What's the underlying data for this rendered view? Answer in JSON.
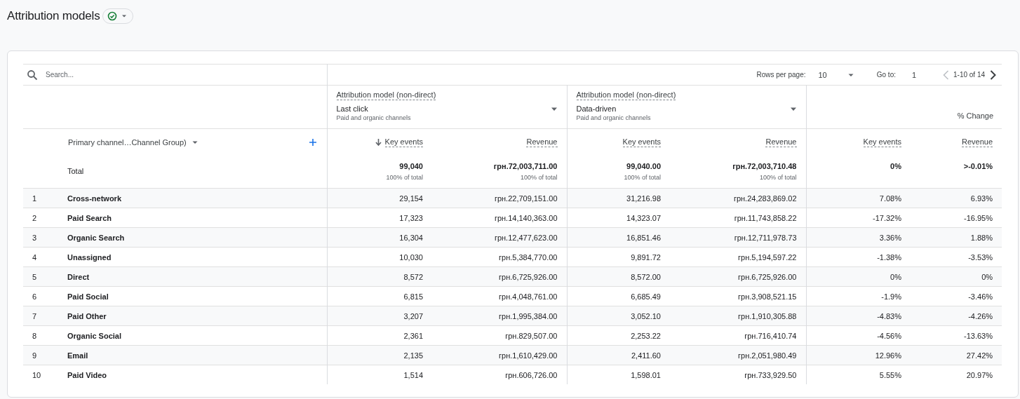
{
  "title": "Attribution models",
  "search": {
    "placeholder": "Search..."
  },
  "pagination": {
    "rows_per_page_label": "Rows per page:",
    "rows_per_page": "10",
    "go_to_label": "Go to:",
    "go_to": "1",
    "range": "1-10 of 14",
    "prev_disabled": true,
    "next_disabled": false
  },
  "models": [
    {
      "label": "Attribution model (non-direct)",
      "model": "Last click",
      "channels": "Paid and organic channels"
    },
    {
      "label": "Attribution model (non-direct)",
      "model": "Data-driven",
      "channels": "Paid and organic channels"
    }
  ],
  "change_header": "% Change",
  "dimension": "Primary channel…Channel Group)",
  "metrics": [
    {
      "label": "Key events",
      "sorted": true
    },
    {
      "label": "Revenue",
      "sorted": false
    },
    {
      "label": "Key events",
      "sorted": false
    },
    {
      "label": "Revenue",
      "sorted": false
    },
    {
      "label": "Key events",
      "sorted": false
    },
    {
      "label": "Revenue",
      "sorted": false
    }
  ],
  "total": {
    "label": "Total",
    "values": [
      {
        "value": "99,040",
        "share": "100% of total"
      },
      {
        "value": "грн.72,003,711.00",
        "share": "100% of total"
      },
      {
        "value": "99,040.00",
        "share": "100% of total"
      },
      {
        "value": "грн.72,003,710.48",
        "share": "100% of total"
      },
      {
        "value": "0%"
      },
      {
        "value": ">-0.01%"
      }
    ]
  },
  "rows": [
    {
      "index": "1",
      "channel": "Cross-network",
      "values": [
        "29,154",
        "грн.22,709,151.00",
        "31,216.98",
        "грн.24,283,869.02",
        "7.08%",
        "6.93%"
      ]
    },
    {
      "index": "2",
      "channel": "Paid Search",
      "values": [
        "17,323",
        "грн.14,140,363.00",
        "14,323.07",
        "грн.11,743,858.22",
        "-17.32%",
        "-16.95%"
      ]
    },
    {
      "index": "3",
      "channel": "Organic Search",
      "values": [
        "16,304",
        "грн.12,477,623.00",
        "16,851.46",
        "грн.12,711,978.73",
        "3.36%",
        "1.88%"
      ]
    },
    {
      "index": "4",
      "channel": "Unassigned",
      "values": [
        "10,030",
        "грн.5,384,770.00",
        "9,891.72",
        "грн.5,194,597.22",
        "-1.38%",
        "-3.53%"
      ]
    },
    {
      "index": "5",
      "channel": "Direct",
      "values": [
        "8,572",
        "грн.6,725,926.00",
        "8,572.00",
        "грн.6,725,926.00",
        "0%",
        "0%"
      ]
    },
    {
      "index": "6",
      "channel": "Paid Social",
      "values": [
        "6,815",
        "грн.4,048,761.00",
        "6,685.49",
        "грн.3,908,521.15",
        "-1.9%",
        "-3.46%"
      ]
    },
    {
      "index": "7",
      "channel": "Paid Other",
      "values": [
        "3,207",
        "грн.1,995,384.00",
        "3,052.10",
        "грн.1,910,305.88",
        "-4.83%",
        "-4.26%"
      ]
    },
    {
      "index": "8",
      "channel": "Organic Social",
      "values": [
        "2,361",
        "грн.829,507.00",
        "2,253.22",
        "грн.716,410.74",
        "-4.56%",
        "-13.63%"
      ]
    },
    {
      "index": "9",
      "channel": "Email",
      "values": [
        "2,135",
        "грн.1,610,429.00",
        "2,411.60",
        "грн.2,051,980.49",
        "12.96%",
        "27.42%"
      ]
    },
    {
      "index": "10",
      "channel": "Paid Video",
      "values": [
        "1,514",
        "грн.606,726.00",
        "1,598.01",
        "грн.733,929.50",
        "5.55%",
        "20.97%"
      ]
    }
  ]
}
